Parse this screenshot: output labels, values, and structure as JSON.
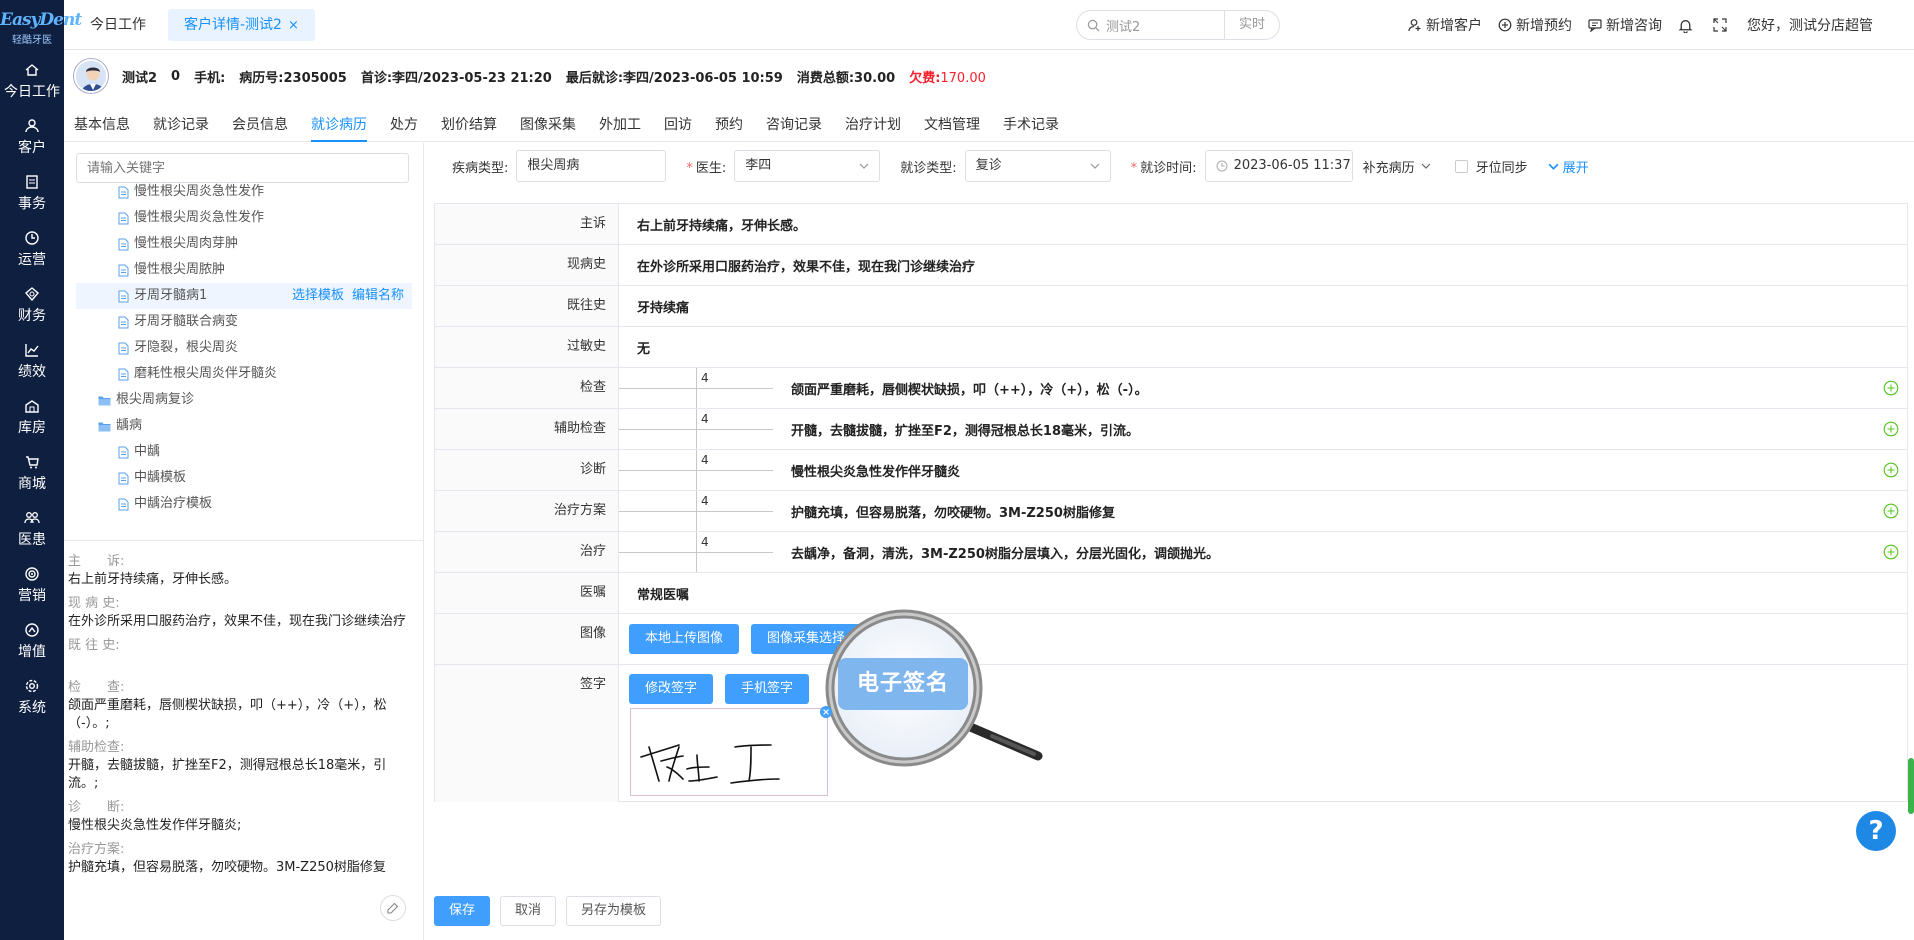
{
  "logo": {
    "brand": "EasyDent",
    "sub": "轻酷牙医"
  },
  "nav": [
    {
      "label": "今日工作",
      "icon": "home-icon"
    },
    {
      "label": "客户",
      "icon": "user-icon"
    },
    {
      "label": "事务",
      "icon": "list-icon"
    },
    {
      "label": "运营",
      "icon": "clock-icon"
    },
    {
      "label": "财务",
      "icon": "money-icon"
    },
    {
      "label": "绩效",
      "icon": "chart-icon"
    },
    {
      "label": "库房",
      "icon": "warehouse-icon"
    },
    {
      "label": "商城",
      "icon": "cart-icon"
    },
    {
      "label": "医患",
      "icon": "doctor-icon"
    },
    {
      "label": "营销",
      "icon": "target-icon"
    },
    {
      "label": "增值",
      "icon": "growth-icon"
    },
    {
      "label": "系统",
      "icon": "gear-icon"
    }
  ],
  "tabs": [
    {
      "label": "今日工作"
    },
    {
      "label": "客户详情-测试2",
      "close": "×"
    }
  ],
  "search": {
    "value": "测试2",
    "mode": "实时"
  },
  "toplinks": {
    "add_customer": "新增客户",
    "add_appt": "新增预约",
    "add_consult": "新增咨询",
    "greeting": "您好，测试分店超管"
  },
  "patient": {
    "name": "测试2",
    "num": "0",
    "phone_label": "手机:",
    "record": "病历号:2305005",
    "first": "首诊:李四/2023-05-23 21:20",
    "last": "最后就诊:李四/2023-06-05 10:59",
    "total": "消费总额:30.00",
    "owe_label": "欠费:",
    "owe_value": "170.00"
  },
  "subtabs": [
    "基本信息",
    "就诊记录",
    "会员信息",
    "就诊病历",
    "处方",
    "划价结算",
    "图像采集",
    "外加工",
    "回访",
    "预约",
    "咨询记录",
    "治疗计划",
    "文档管理",
    "手术记录"
  ],
  "left": {
    "keyword_placeholder": "请输入关键字",
    "tree": [
      {
        "label": "慢性根尖周炎急性发作",
        "level": 2
      },
      {
        "label": "慢性根尖周炎急性发作",
        "level": 2
      },
      {
        "label": "慢性根尖周肉芽肿",
        "level": 2
      },
      {
        "label": "慢性根尖周脓肿",
        "level": 2
      },
      {
        "label": "牙周牙髓病1",
        "level": 2,
        "selected": true,
        "act1": "选择模板",
        "act2": "编辑名称"
      },
      {
        "label": "牙周牙髓联合病变",
        "level": 2
      },
      {
        "label": "牙隐裂，根尖周炎",
        "level": 2
      },
      {
        "label": "磨耗性根尖周炎伴牙髓炎",
        "level": 2
      },
      {
        "label": "根尖周病复诊",
        "level": 1
      },
      {
        "label": "龋病",
        "level": 1
      },
      {
        "label": "中龋",
        "level": 2
      },
      {
        "label": "中龋模板",
        "level": 2
      },
      {
        "label": "中龋治疗模板",
        "level": 2
      }
    ],
    "summary": [
      {
        "label": "主　　诉:",
        "value": "右上前牙持续痛，牙伸长感。"
      },
      {
        "label": "现 病 史:",
        "value": "在外诊所采用口服药治疗，效果不佳，现在我门诊继续治疗"
      },
      {
        "label": "既 往 史:",
        "value": ""
      },
      {
        "label": "检　　查:",
        "value": "颌面严重磨耗，唇侧楔状缺损，叩（++），冷（+），松（-）。;"
      },
      {
        "label": "辅助检查:",
        "value": "开髓，去髓拔髓，扩挫至F2，测得冠根总长18毫米，引流。;"
      },
      {
        "label": "诊　　断:",
        "value": "慢性根尖炎急性发作伴牙髓炎;"
      },
      {
        "label": "治疗方案:",
        "value": "护髓充填，但容易脱落，勿咬硬物。3M-Z250树脂修复"
      }
    ]
  },
  "form": {
    "type_label": "疾病类型:",
    "type_value": "根尖周病",
    "doctor_label": "医生:",
    "doctor_value": "李四",
    "visit_label": "就诊类型:",
    "visit_value": "复诊",
    "time_label": "就诊时间:",
    "time_value": "2023-06-05 11:37",
    "supplement": "补充病历",
    "sync": "牙位同步",
    "expand": "展开"
  },
  "rows": {
    "cc": {
      "label": "主诉",
      "value": "右上前牙持续痛，牙伸长感。"
    },
    "hpi": {
      "label": "现病史",
      "value": "在外诊所采用口服药治疗，效果不佳，现在我门诊继续治疗"
    },
    "pmh": {
      "label": "既往史",
      "value": "牙持续痛"
    },
    "allergy": {
      "label": "过敏史",
      "value": "无"
    },
    "exam": {
      "label": "检查",
      "tooth": "4",
      "value": "颌面严重磨耗，唇侧楔状缺损，叩（++），冷（+），松（-）。"
    },
    "aux": {
      "label": "辅助检查",
      "tooth": "4",
      "value": "开髓，去髓拔髓，扩挫至F2，测得冠根总长18毫米，引流。"
    },
    "diag": {
      "label": "诊断",
      "tooth": "4",
      "value": "慢性根尖炎急性发作伴牙髓炎"
    },
    "plan": {
      "label": "治疗方案",
      "tooth": "4",
      "value": "护髓充填，但容易脱落，勿咬硬物。3M-Z250树脂修复"
    },
    "treat": {
      "label": "治疗",
      "tooth": "4",
      "value": "去龋净，备洞，清洗，3M-Z250树脂分层填入，分层光固化，调颌抛光。"
    },
    "advice": {
      "label": "医嘱",
      "value": "常规医嘱"
    },
    "image": {
      "label": "图像",
      "upload": "本地上传图像",
      "capture": "图像采集选择"
    },
    "sign": {
      "label": "签字",
      "modify": "修改签字",
      "mobile": "手机签字",
      "esign": "电子签名"
    }
  },
  "bottom": {
    "save": "保存",
    "cancel": "取消",
    "save_tpl": "另存为模板"
  },
  "help": "?"
}
